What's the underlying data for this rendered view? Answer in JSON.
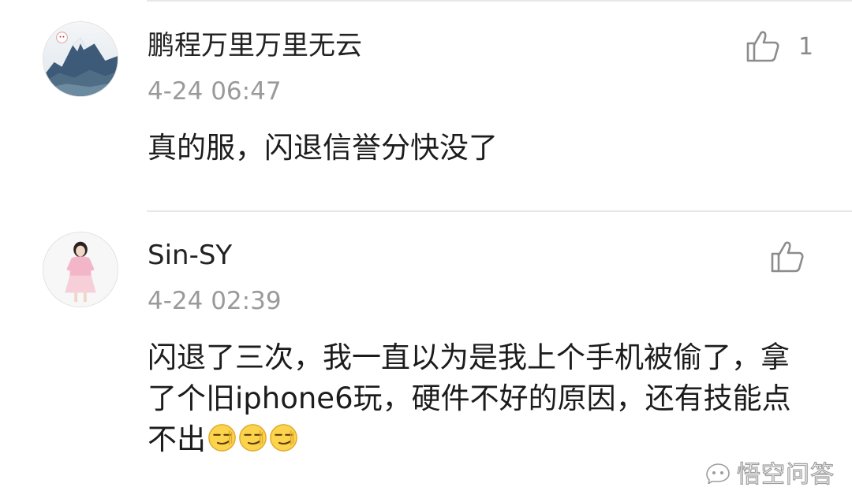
{
  "comments": [
    {
      "username": "鹏程万里万里无云",
      "timestamp": "4-24 06:47",
      "text": "真的服，闪退信誉分快没了",
      "like_count": "1",
      "avatar": "mountain-avatar"
    },
    {
      "username": "Sin-SY",
      "timestamp": "4-24 02:39",
      "text": "闪退了三次，我一直以为是我上个手机被偷了，拿了个旧iphone6玩，硬件不好的原因，还有技能点不出",
      "emojis": [
        "smirk-emoji",
        "smirk-emoji",
        "smirk-emoji"
      ],
      "avatar": "girl-avatar"
    }
  ],
  "watermark": {
    "text": "悟空问答",
    "icon": "wukong-logo-icon"
  },
  "colors": {
    "divider": "#e7e7e7",
    "timestamp": "#9a9a9a",
    "icon_stroke": "#8c8c8c"
  }
}
